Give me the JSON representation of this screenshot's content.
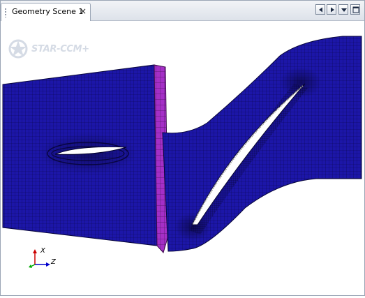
{
  "window": {
    "tab_title": "Geometry Scene 1",
    "close_glyph": "×"
  },
  "toolbar": {
    "buttons": [
      {
        "name": "scroll-left",
        "icon": "triangle-left-icon"
      },
      {
        "name": "scroll-right",
        "icon": "triangle-right-icon"
      },
      {
        "name": "dropdown",
        "icon": "triangle-down-icon"
      },
      {
        "name": "maximize",
        "icon": "maximize-icon"
      }
    ]
  },
  "scene": {
    "logo_text": "STAR-CCM+",
    "axes": {
      "x_label": "X",
      "z_label": "Z"
    },
    "colors": {
      "mesh_blue": "#1c16a8",
      "interface_magenta": "#a52fc7",
      "background": "#ffffff",
      "axis_x": "#cc0000",
      "axis_y": "#00aa00",
      "axis_z": "#0000cc"
    }
  }
}
